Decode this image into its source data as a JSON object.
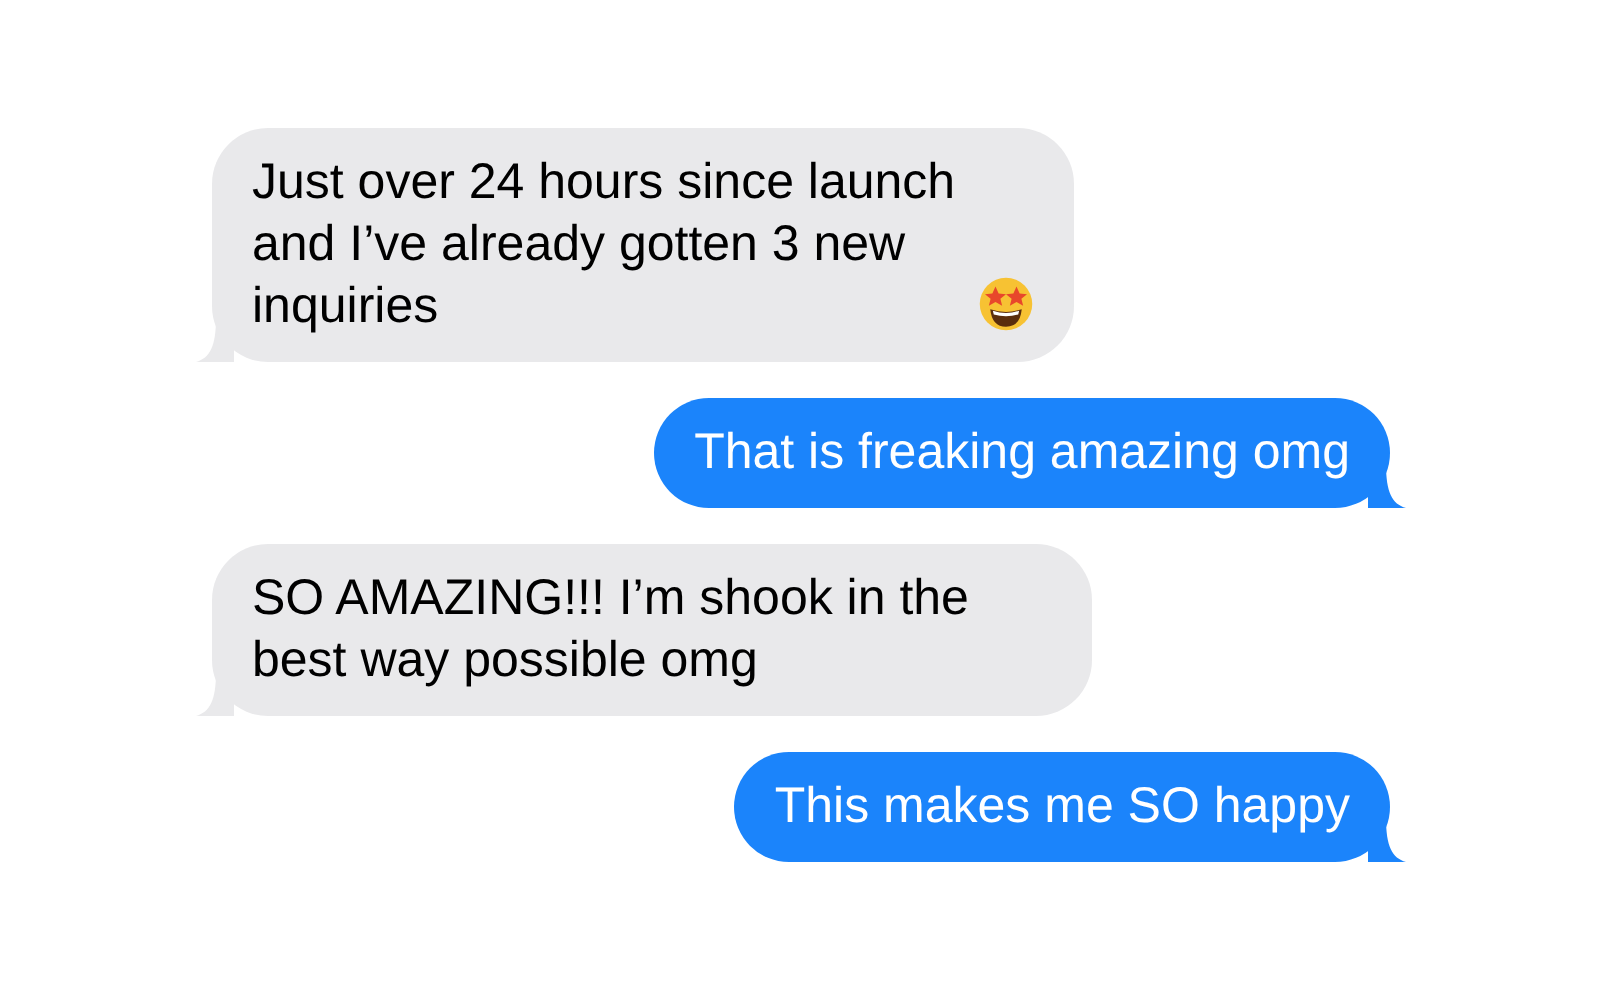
{
  "messages": [
    {
      "kind": "received",
      "text": "Just over 24 hours since launch and I’ve already gotten 3 new inquiries"
    },
    {
      "kind": "sent",
      "text": "That is freaking amazing omg"
    },
    {
      "kind": "received",
      "text": "SO AMAZING!!! I’m shook in the best way possible omg"
    },
    {
      "kind": "sent",
      "text": "This makes me SO happy"
    }
  ]
}
